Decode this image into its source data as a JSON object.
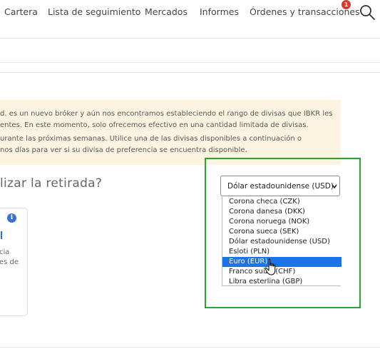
{
  "nav": {
    "items": [
      "Cartera",
      "Lista de seguimiento",
      "Mercados",
      "Informes",
      "Órdenes y transacciones"
    ],
    "badge_count": "1"
  },
  "notice": {
    "lines": [
      "d. es un nuevo bróker y aún nos encontramos estableciendo el rango de divisas que IBKR les",
      "entes. En este momento, solo ofrecemos efectivo en una cantidad limitada de divisas.",
      "urante las próximas semanas. Utilice una de las divisas disponibles a continuación o",
      "nos días para ver si su divisa de preferencia se encuentra disponible."
    ]
  },
  "question": "lizar la retirada?",
  "card": {
    "info_glyph": "i",
    "lines": [
      "cia",
      "es de"
    ]
  },
  "currency_select": {
    "value": "Dólar estadounidense (USD)",
    "options": [
      "Corona checa (CZK)",
      "Corona danesa (DKK)",
      "Corona noruega (NOK)",
      "Corona sueca (SEK)",
      "Dólar estadounidense (USD)",
      "Esloti (PLN)",
      "Euro (EUR)",
      "Franco suizo (CHF)",
      "Libra esterlina (GBP)"
    ],
    "highlighted_option": "Euro (EUR)"
  },
  "colors": {
    "highlight_box": "#2aa332",
    "selected_option": "#1a73e8",
    "notice_bg": "#fdf3e1",
    "badge": "#d83a2c"
  },
  "icons": [
    "search-icon",
    "info-icon",
    "chevron-down-icon",
    "hand-cursor-icon"
  ]
}
